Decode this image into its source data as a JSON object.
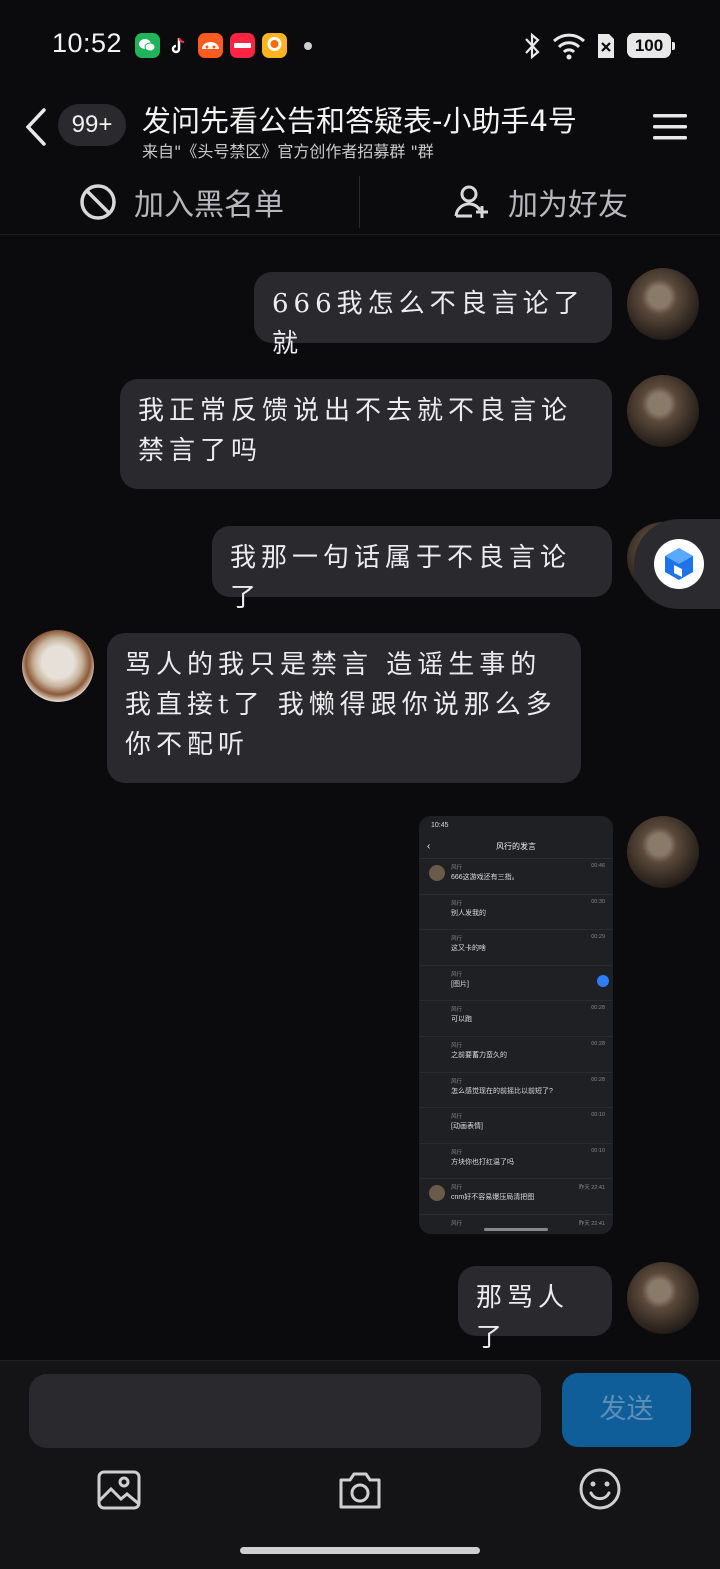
{
  "status_bar": {
    "time": "10:52",
    "battery": "100",
    "app_icons": [
      "wechat-icon",
      "tiktok-icon",
      "orange-app-icon",
      "xiaohongshu-icon",
      "yellow-app-icon"
    ]
  },
  "header": {
    "back_badge": "99+",
    "title": "发问先看公告和答疑表-小助手4号",
    "subtitle": "来自\"《头号禁区》官方创作者招募群 \"群"
  },
  "actions": {
    "block_label": "加入黑名单",
    "add_friend_label": "加为好友"
  },
  "messages": [
    {
      "side": "right",
      "text": "666我怎么不良言论了就"
    },
    {
      "side": "right",
      "text": "我正常反馈说出不去就不良言论禁言了吗"
    },
    {
      "side": "right",
      "text": "我那一句话属于不良言论了"
    },
    {
      "side": "left",
      "text": "骂人的我只是禁言 造谣生事的我直接t了 我懒得跟你说那么多 你不配听"
    },
    {
      "side": "right",
      "type": "image"
    },
    {
      "side": "right",
      "text": "那骂人了"
    }
  ],
  "screenshot": {
    "time": "10:45",
    "title": "风行的发言",
    "rows": [
      {
        "name": "风行",
        "text": "666这游戏还有三指。",
        "time": "00:46"
      },
      {
        "name": "风行",
        "text": "别人发我的",
        "time": "00:30"
      },
      {
        "name": "风行",
        "text": "这又卡的啥",
        "time": "00:29"
      },
      {
        "name": "风行",
        "text": "[图片]",
        "time": ""
      },
      {
        "name": "风行",
        "text": "可以跑",
        "time": "00:28"
      },
      {
        "name": "风行",
        "text": "之前要蓄力蛮久的",
        "time": "00:28"
      },
      {
        "name": "风行",
        "text": "怎么感觉现在的前摇比以前短了?",
        "time": "00:28"
      },
      {
        "name": "风行",
        "text": "[动画表情]",
        "time": "00:10"
      },
      {
        "name": "风行",
        "text": "方块你也打红温了吗",
        "time": "00:10"
      },
      {
        "name": "风行",
        "text": "cnm好不容易爆压局清把图",
        "time": "昨天 22:41"
      },
      {
        "name": "风行",
        "text": "",
        "time": "昨天 22:41"
      }
    ]
  },
  "composer": {
    "send_label": "发送",
    "input_value": ""
  }
}
